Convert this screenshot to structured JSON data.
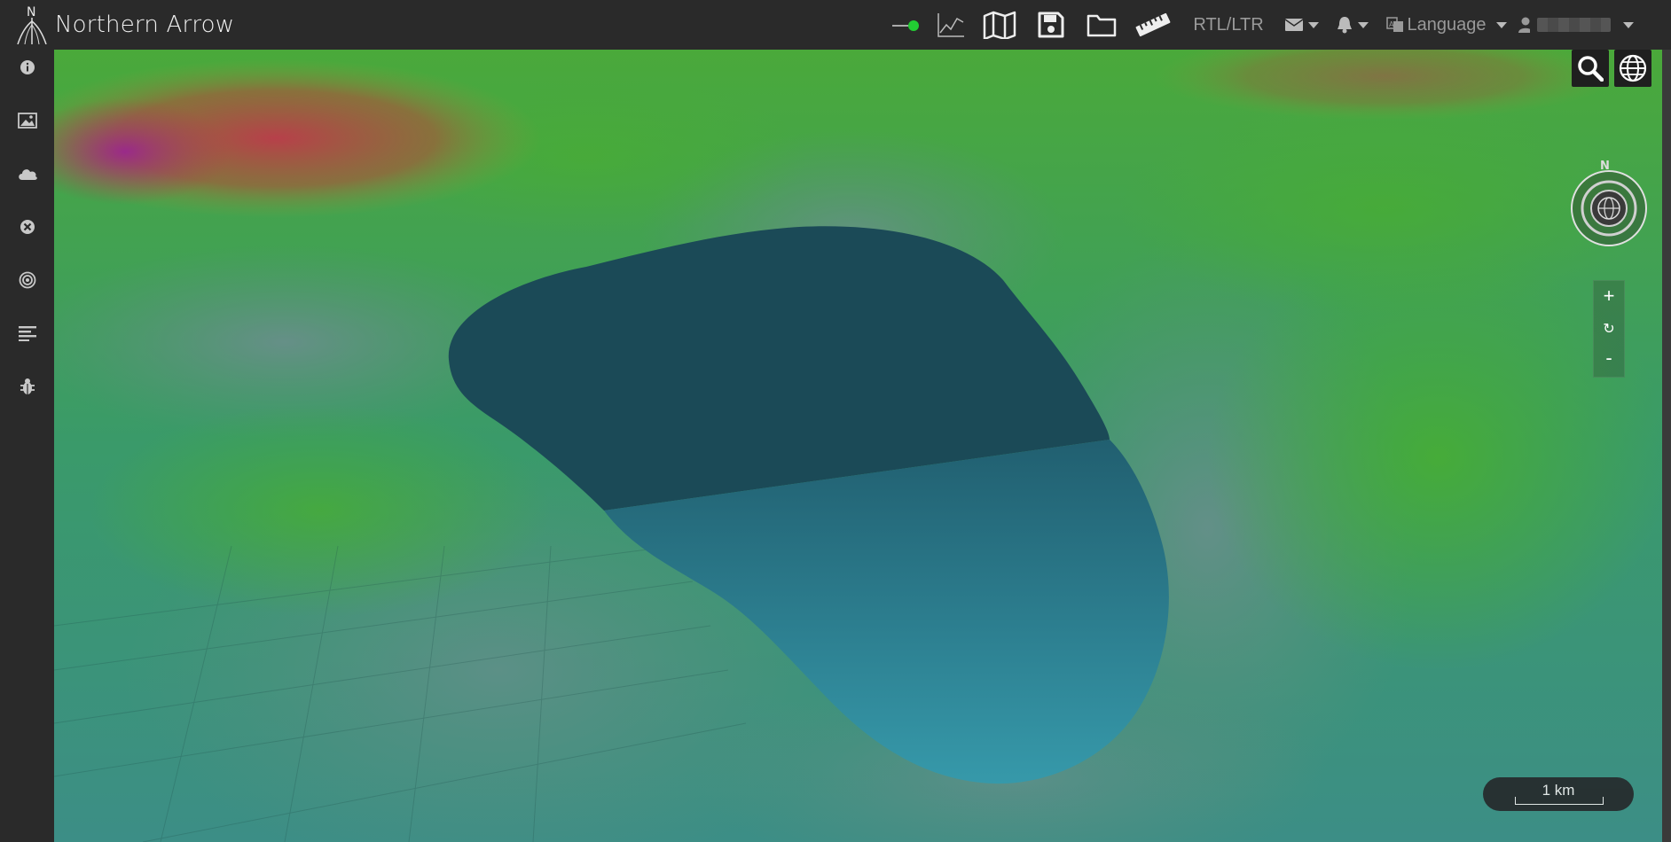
{
  "app": {
    "title": "Northern Arrow",
    "logo_letter": "N"
  },
  "toolbar": {
    "status": {
      "icon": "status-connected-icon",
      "color": "#22cc33"
    },
    "items": [
      {
        "name": "profile-chart-button",
        "icon": "line-chart-icon"
      },
      {
        "name": "map-button",
        "icon": "map-icon"
      },
      {
        "name": "save-button",
        "icon": "floppy-disk-icon"
      },
      {
        "name": "open-folder-button",
        "icon": "folder-icon"
      },
      {
        "name": "measure-button",
        "icon": "ruler-icon"
      }
    ],
    "direction_toggle": "RTL/LTR",
    "messages": {
      "icon": "envelope-icon"
    },
    "notifications": {
      "icon": "bell-icon"
    },
    "language": {
      "icon": "translate-icon",
      "label": "Language"
    },
    "user": {
      "icon": "user-icon"
    }
  },
  "sidebar": {
    "items": [
      {
        "name": "sidebar-info",
        "icon": "info-icon"
      },
      {
        "name": "sidebar-imagery",
        "icon": "image-icon"
      },
      {
        "name": "sidebar-weather",
        "icon": "cloud-icon"
      },
      {
        "name": "sidebar-clear",
        "icon": "close-circle-icon"
      },
      {
        "name": "sidebar-target",
        "icon": "target-icon"
      },
      {
        "name": "sidebar-layers",
        "icon": "align-left-icon"
      },
      {
        "name": "sidebar-debug",
        "icon": "bug-icon"
      }
    ]
  },
  "map": {
    "controls": {
      "search": {
        "icon": "search-icon"
      },
      "globe": {
        "icon": "globe-icon"
      },
      "compass_letter": "N",
      "zoom_in": "+",
      "reset": "↻",
      "zoom_out": "-"
    },
    "scale_label": "1 km"
  },
  "colors": {
    "topbar": "#2a2a2a",
    "lake_dark": "#1b4a57",
    "lake_light": "#2a8c9e",
    "terrain_green": "#3fa832",
    "terrain_red": "#b0473f"
  }
}
